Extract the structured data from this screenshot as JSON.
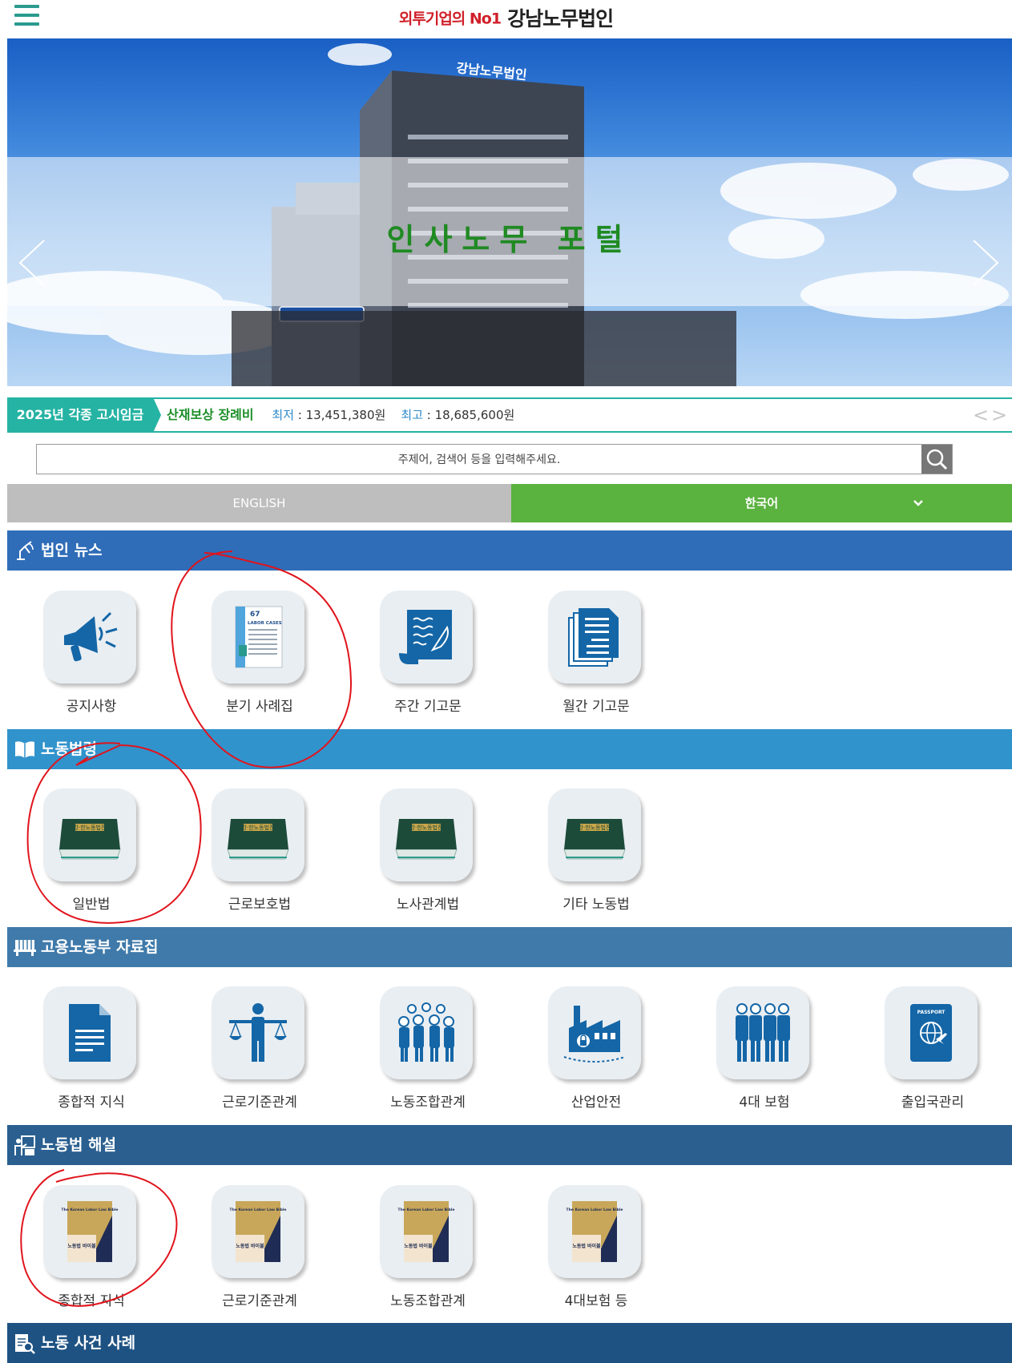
{
  "header": {
    "logo_tagline": "외투기업의 No1",
    "logo_name": "강남노무법인"
  },
  "banner": {
    "title": "인사노무 포털",
    "building_sign": "강남노무법인"
  },
  "ticker": {
    "label": "2025년 각종 고시임금",
    "item": "산재보상 장례비",
    "min_key": "최저",
    "min_value": ": 13,451,380원",
    "max_key": "최고",
    "max_value": ": 18,685,600원",
    "prev": "<",
    "next": ">"
  },
  "search": {
    "placeholder": "주제어, 검색어 등을 입력해주세요."
  },
  "language": {
    "english": "ENGLISH",
    "korean": "한국어"
  },
  "sections": [
    {
      "title": "법인 뉴스",
      "color": "#2f6db8",
      "items": [
        {
          "label": "공지사항",
          "icon": "megaphone-icon"
        },
        {
          "label": "분기 사례집",
          "icon": "booklet-icon"
        },
        {
          "label": "주간 기고문",
          "icon": "scroll-quill-icon"
        },
        {
          "label": "월간 기고문",
          "icon": "documents-icon"
        }
      ]
    },
    {
      "title": "노동법령",
      "color": "#3193cc",
      "items": [
        {
          "label": "일반법",
          "icon": "law-book-icon"
        },
        {
          "label": "근로보호법",
          "icon": "law-book-icon"
        },
        {
          "label": "노사관계법",
          "icon": "law-book-icon"
        },
        {
          "label": "기타 노동법",
          "icon": "law-book-icon"
        }
      ]
    },
    {
      "title": "고용노동부 자료집",
      "color": "#3f7aaa",
      "items": [
        {
          "label": "종합적 지식",
          "icon": "document-icon"
        },
        {
          "label": "근로기준관계",
          "icon": "scales-person-icon"
        },
        {
          "label": "노동조합관계",
          "icon": "group-people-icon"
        },
        {
          "label": "산업안전",
          "icon": "factory-icon"
        },
        {
          "label": "4대 보험",
          "icon": "four-people-icon"
        },
        {
          "label": "출입국관리",
          "icon": "passport-icon"
        }
      ]
    },
    {
      "title": "노동법 해설",
      "color": "#2a5f90",
      "items": [
        {
          "label": "종합적 지식",
          "icon": "labor-book-icon"
        },
        {
          "label": "근로기준관계",
          "icon": "labor-book-icon"
        },
        {
          "label": "노동조합관계",
          "icon": "labor-book-icon"
        },
        {
          "label": "4대보험 등",
          "icon": "labor-book-icon"
        }
      ]
    },
    {
      "title": "노동 사건 사례",
      "color": "#1e5283",
      "items": []
    }
  ],
  "booklet_cover": {
    "issue": "67",
    "title": "LABOR CASES"
  },
  "law_book_cover": {
    "title": "강·한노동법전"
  },
  "labor_book_cover": {
    "title": "The Korean Labor Law Bible",
    "subtitle": "노동법 바이블"
  },
  "passport_text": "PASSPORT"
}
